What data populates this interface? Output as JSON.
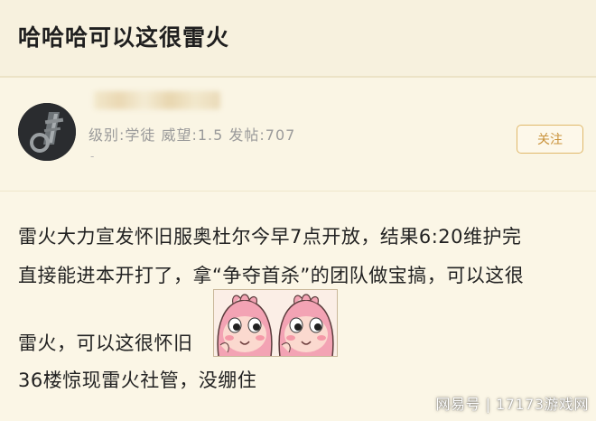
{
  "post": {
    "title": "哈哈哈可以这很雷火"
  },
  "author": {
    "meta": "级别:学徒 威望:1.5 发帖:707",
    "meta_sub": "-",
    "follow_label": "关注"
  },
  "content": {
    "line1": "雷火大力宣发怀旧服奥杜尔今早7点开放，结果6:20维护完",
    "line2": "直接能进本开打了，拿“争夺首杀”的团队做宝搞，可以这很",
    "line3": "雷火，可以这很怀旧",
    "line4": "36楼惊现雷火社管，没绷住",
    "emojis": [
      "laughing-pink-face",
      "laughing-pink-face"
    ]
  },
  "watermark": "网易号 | 17173游戏网"
}
